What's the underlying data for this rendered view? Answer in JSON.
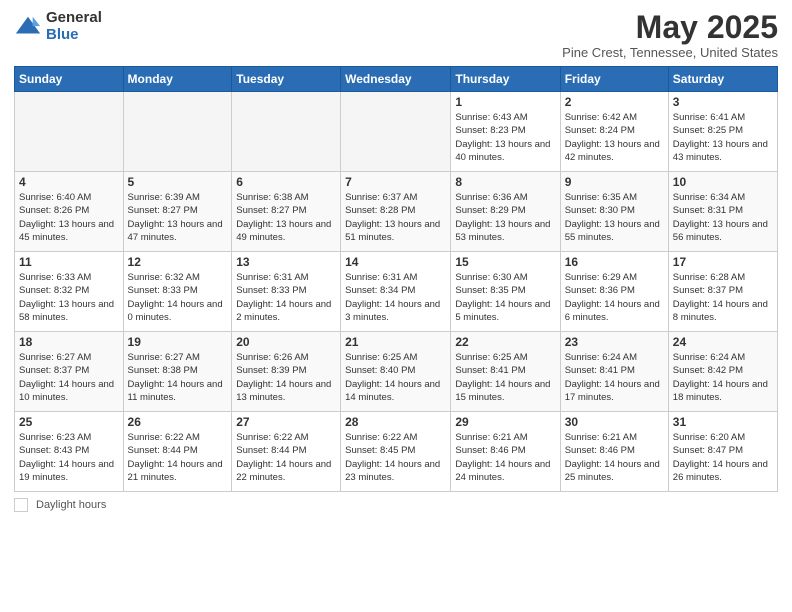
{
  "logo": {
    "general": "General",
    "blue": "Blue"
  },
  "title": "May 2025",
  "subtitle": "Pine Crest, Tennessee, United States",
  "days_of_week": [
    "Sunday",
    "Monday",
    "Tuesday",
    "Wednesday",
    "Thursday",
    "Friday",
    "Saturday"
  ],
  "footer": {
    "daylight_label": "Daylight hours"
  },
  "weeks": [
    [
      {
        "day": "",
        "empty": true
      },
      {
        "day": "",
        "empty": true
      },
      {
        "day": "",
        "empty": true
      },
      {
        "day": "",
        "empty": true
      },
      {
        "day": "1",
        "sunrise": "6:43 AM",
        "sunset": "8:23 PM",
        "daylight": "13 hours and 40 minutes."
      },
      {
        "day": "2",
        "sunrise": "6:42 AM",
        "sunset": "8:24 PM",
        "daylight": "13 hours and 42 minutes."
      },
      {
        "day": "3",
        "sunrise": "6:41 AM",
        "sunset": "8:25 PM",
        "daylight": "13 hours and 43 minutes."
      }
    ],
    [
      {
        "day": "4",
        "sunrise": "6:40 AM",
        "sunset": "8:26 PM",
        "daylight": "13 hours and 45 minutes."
      },
      {
        "day": "5",
        "sunrise": "6:39 AM",
        "sunset": "8:27 PM",
        "daylight": "13 hours and 47 minutes."
      },
      {
        "day": "6",
        "sunrise": "6:38 AM",
        "sunset": "8:27 PM",
        "daylight": "13 hours and 49 minutes."
      },
      {
        "day": "7",
        "sunrise": "6:37 AM",
        "sunset": "8:28 PM",
        "daylight": "13 hours and 51 minutes."
      },
      {
        "day": "8",
        "sunrise": "6:36 AM",
        "sunset": "8:29 PM",
        "daylight": "13 hours and 53 minutes."
      },
      {
        "day": "9",
        "sunrise": "6:35 AM",
        "sunset": "8:30 PM",
        "daylight": "13 hours and 55 minutes."
      },
      {
        "day": "10",
        "sunrise": "6:34 AM",
        "sunset": "8:31 PM",
        "daylight": "13 hours and 56 minutes."
      }
    ],
    [
      {
        "day": "11",
        "sunrise": "6:33 AM",
        "sunset": "8:32 PM",
        "daylight": "13 hours and 58 minutes."
      },
      {
        "day": "12",
        "sunrise": "6:32 AM",
        "sunset": "8:33 PM",
        "daylight": "14 hours and 0 minutes."
      },
      {
        "day": "13",
        "sunrise": "6:31 AM",
        "sunset": "8:33 PM",
        "daylight": "14 hours and 2 minutes."
      },
      {
        "day": "14",
        "sunrise": "6:31 AM",
        "sunset": "8:34 PM",
        "daylight": "14 hours and 3 minutes."
      },
      {
        "day": "15",
        "sunrise": "6:30 AM",
        "sunset": "8:35 PM",
        "daylight": "14 hours and 5 minutes."
      },
      {
        "day": "16",
        "sunrise": "6:29 AM",
        "sunset": "8:36 PM",
        "daylight": "14 hours and 6 minutes."
      },
      {
        "day": "17",
        "sunrise": "6:28 AM",
        "sunset": "8:37 PM",
        "daylight": "14 hours and 8 minutes."
      }
    ],
    [
      {
        "day": "18",
        "sunrise": "6:27 AM",
        "sunset": "8:37 PM",
        "daylight": "14 hours and 10 minutes."
      },
      {
        "day": "19",
        "sunrise": "6:27 AM",
        "sunset": "8:38 PM",
        "daylight": "14 hours and 11 minutes."
      },
      {
        "day": "20",
        "sunrise": "6:26 AM",
        "sunset": "8:39 PM",
        "daylight": "14 hours and 13 minutes."
      },
      {
        "day": "21",
        "sunrise": "6:25 AM",
        "sunset": "8:40 PM",
        "daylight": "14 hours and 14 minutes."
      },
      {
        "day": "22",
        "sunrise": "6:25 AM",
        "sunset": "8:41 PM",
        "daylight": "14 hours and 15 minutes."
      },
      {
        "day": "23",
        "sunrise": "6:24 AM",
        "sunset": "8:41 PM",
        "daylight": "14 hours and 17 minutes."
      },
      {
        "day": "24",
        "sunrise": "6:24 AM",
        "sunset": "8:42 PM",
        "daylight": "14 hours and 18 minutes."
      }
    ],
    [
      {
        "day": "25",
        "sunrise": "6:23 AM",
        "sunset": "8:43 PM",
        "daylight": "14 hours and 19 minutes."
      },
      {
        "day": "26",
        "sunrise": "6:22 AM",
        "sunset": "8:44 PM",
        "daylight": "14 hours and 21 minutes."
      },
      {
        "day": "27",
        "sunrise": "6:22 AM",
        "sunset": "8:44 PM",
        "daylight": "14 hours and 22 minutes."
      },
      {
        "day": "28",
        "sunrise": "6:22 AM",
        "sunset": "8:45 PM",
        "daylight": "14 hours and 23 minutes."
      },
      {
        "day": "29",
        "sunrise": "6:21 AM",
        "sunset": "8:46 PM",
        "daylight": "14 hours and 24 minutes."
      },
      {
        "day": "30",
        "sunrise": "6:21 AM",
        "sunset": "8:46 PM",
        "daylight": "14 hours and 25 minutes."
      },
      {
        "day": "31",
        "sunrise": "6:20 AM",
        "sunset": "8:47 PM",
        "daylight": "14 hours and 26 minutes."
      }
    ]
  ]
}
